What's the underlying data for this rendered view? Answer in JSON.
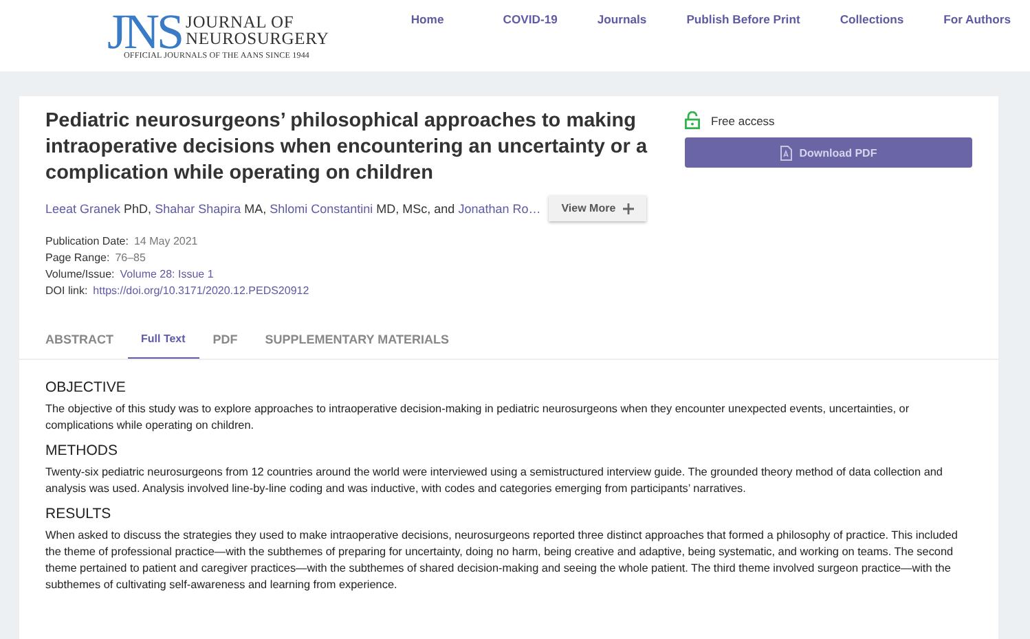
{
  "logo": {
    "mark": "JNS",
    "name_line1": "JOURNAL OF",
    "name_line2": "NEUROSURGERY",
    "tagline": "OFFICIAL JOURNALS OF THE AANS SINCE 1944"
  },
  "nav": [
    "Home",
    "COVID-19",
    "Journals",
    "Publish Before Print",
    "Collections",
    "For Authors"
  ],
  "article": {
    "title": "Pediatric neurosurgeons’ philosophical approaches to making intraoperative decisions when encountering an uncertainty or a complication while operating on children",
    "authors": [
      {
        "name": "Leeat Granek",
        "suffix": " PhD, "
      },
      {
        "name": "Shahar Shapira",
        "suffix": " MA, "
      },
      {
        "name": "Shlomi Constantini",
        "suffix": " MD, MSc, and "
      },
      {
        "name": "Jonathan Ro…"
      }
    ],
    "view_more": "View More",
    "meta": [
      {
        "label": "Publication Date:",
        "value": "14 May 2021",
        "link": false
      },
      {
        "label": "Page Range:",
        "value": "76–85",
        "link": false
      },
      {
        "label": "Volume/Issue:",
        "value": "Volume 28: Issue 1",
        "link": true
      },
      {
        "label": "DOI link:",
        "value": "https://doi.org/10.3171/2020.12.PEDS20912",
        "link": true
      }
    ],
    "access": "Free access",
    "download": "Download PDF"
  },
  "tabs": [
    {
      "label": "ABSTRACT",
      "selected": false
    },
    {
      "label": "Full Text",
      "selected": true
    },
    {
      "label": "PDF",
      "selected": false
    },
    {
      "label": "SUPPLEMENTARY MATERIALS",
      "selected": false
    }
  ],
  "sections": [
    {
      "heading": "OBJECTIVE",
      "text": "The objective of this study was to explore approaches to intraoperative decision-making in pediatric neurosurgeons when they encounter unexpected events, uncertainties, or complications while operating on children."
    },
    {
      "heading": "METHODS",
      "text": "Twenty-six pediatric neurosurgeons from 12 countries around the world were interviewed using a semistructured interview guide. The grounded theory method of data collection and analysis was used. Analysis involved line-by-line coding and was inductive, with codes and categories emerging from participants’ narratives."
    },
    {
      "heading": "RESULTS",
      "text": "When asked to discuss the strategies they used to make intraoperative decisions, neurosurgeons reported three distinct approaches that formed a philosophy of practice. This included the theme of professional practice—with the subthemes of preparing for uncertainty, doing no harm, being creative and adaptive, being systematic, and working on teams. The second theme pertained to patient and caregiver practices—with the subthemes of shared decision-making and seeing the whole patient. The third theme involved surgeon practice—with the subthemes of cultivating self-awareness and learning from experience."
    }
  ]
}
